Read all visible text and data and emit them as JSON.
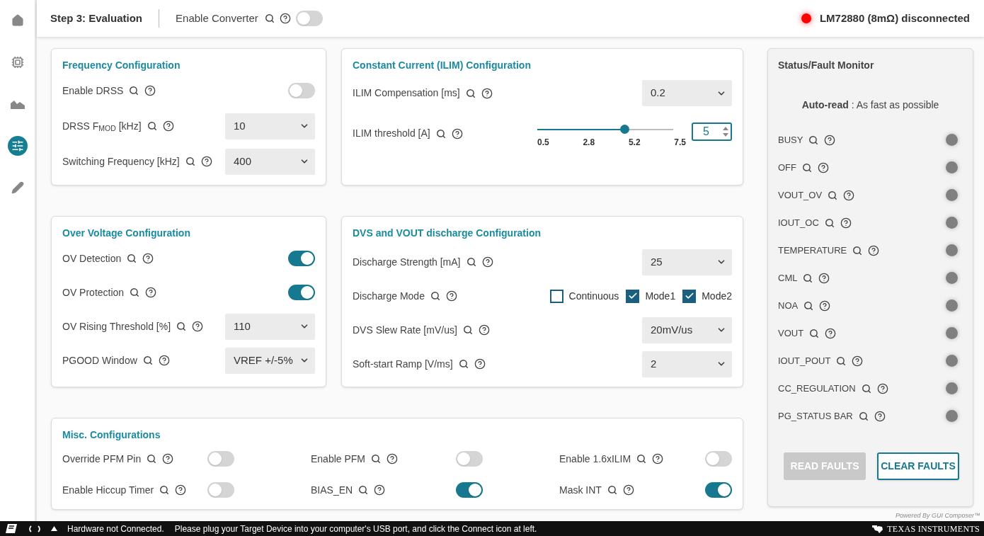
{
  "sidebar": {
    "items": [
      {
        "kind": "home",
        "selected": false
      },
      {
        "kind": "chip",
        "selected": false
      },
      {
        "kind": "chart",
        "selected": false
      },
      {
        "kind": "settings",
        "selected": true
      },
      {
        "kind": "edit",
        "selected": false
      }
    ]
  },
  "header": {
    "title": "Step 3: Evaluation",
    "converter": {
      "label": "Enable Converter",
      "on": false
    },
    "device": {
      "label": "LM72880 (8mΩ) disconnected",
      "connected": false
    }
  },
  "cards": [
    {
      "title": "Frequency Configuration",
      "rows": [
        {
          "kind": "toggle",
          "label": "Enable DRSS",
          "on": false
        },
        {
          "kind": "select",
          "label": "DRSS F$_{MOD}$ [kHz]",
          "value": "10"
        },
        {
          "kind": "select",
          "label": "Switching Frequency [kHz]",
          "value": "400"
        }
      ]
    },
    {
      "title": "Constant Current (ILIM) Configuration",
      "rows": [
        {
          "kind": "select",
          "label": "ILIM Compensation [ms]",
          "value": "0.2"
        },
        {
          "kind": "slider",
          "label": "ILIM threshold [A]",
          "level": 0.643,
          "ticks": [
            "0.5",
            "2.8",
            "5.2",
            "7.5"
          ],
          "value": "5"
        }
      ]
    },
    {
      "title": "Over Voltage Configuration",
      "rows": [
        {
          "kind": "toggle",
          "label": "OV Detection",
          "on": true
        },
        {
          "kind": "toggle",
          "label": "OV Protection",
          "on": true
        },
        {
          "kind": "select",
          "label": "OV Rising Threshold [%]",
          "value": "110"
        },
        {
          "kind": "select",
          "label": "PGOOD Window",
          "value": "VREF +/-5%"
        }
      ]
    },
    {
      "title": "DVS and VOUT discharge Configuration",
      "rows": [
        {
          "kind": "select",
          "label": "Discharge Strength [mA]",
          "value": "25"
        },
        {
          "kind": "checks",
          "label": "Discharge Mode",
          "options": [
            {
              "label": "Continuous",
              "checked": false
            },
            {
              "label": "Mode1",
              "checked": true
            },
            {
              "label": "Mode2",
              "checked": true
            }
          ]
        },
        {
          "kind": "select",
          "label": "DVS Slew Rate [mV/us]",
          "value": "20mV/us"
        },
        {
          "kind": "select",
          "label": "Soft-start Ramp [V/ms]",
          "value": "2"
        }
      ]
    }
  ],
  "misc": {
    "title": "Misc. Configurations",
    "items": [
      {
        "label": "Override PFM Pin",
        "on": false
      },
      {
        "label": "Enable PFM",
        "on": false
      },
      {
        "label": "Enable 1.6xILIM",
        "on": false
      },
      {
        "label": "Enable Hiccup Timer",
        "on": false
      },
      {
        "label": "BIAS_EN",
        "on": true
      },
      {
        "label": "Mask INT",
        "on": true
      }
    ]
  },
  "status": {
    "title": "Status/Fault Monitor",
    "auto_read": "**Auto-read** : As fast as possible",
    "flags": [
      {
        "label": "BUSY"
      },
      {
        "label": "OFF"
      },
      {
        "label": "VOUT_OV"
      },
      {
        "label": "IOUT_OC"
      },
      {
        "label": "TEMPERATURE"
      },
      {
        "label": "CML"
      },
      {
        "label": "NOA"
      },
      {
        "label": "VOUT"
      },
      {
        "label": "IOUT_POUT"
      },
      {
        "label": "CC_REGULATION"
      },
      {
        "label": "PG_STATUS BAR"
      }
    ],
    "buttons": [
      {
        "label": "READ FAULTS",
        "disabled": true
      },
      {
        "label": "CLEAR FAULTS",
        "disabled": false
      }
    ]
  },
  "powered_by": "Powered By GUI Composer™",
  "status_bar": {
    "state": "Hardware not Connected.",
    "message": "Please plug your Target Device into your computer's USB port, and click the Connect icon at left.",
    "brand": "TEXAS INSTRUMENTS"
  }
}
